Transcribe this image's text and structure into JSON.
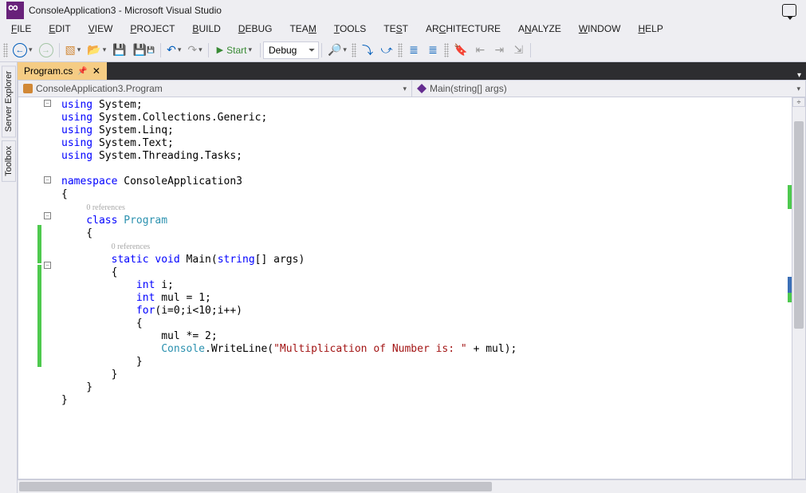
{
  "title": "ConsoleApplication3 - Microsoft Visual Studio",
  "menu": {
    "items": [
      {
        "label": "FILE",
        "key": "F"
      },
      {
        "label": "EDIT",
        "key": "E"
      },
      {
        "label": "VIEW",
        "key": "V"
      },
      {
        "label": "PROJECT",
        "key": "P"
      },
      {
        "label": "BUILD",
        "key": "B"
      },
      {
        "label": "DEBUG",
        "key": "D"
      },
      {
        "label": "TEAM",
        "key": "M"
      },
      {
        "label": "TOOLS",
        "key": "T"
      },
      {
        "label": "TEST",
        "key": "S"
      },
      {
        "label": "ARCHITECTURE",
        "key": "C"
      },
      {
        "label": "ANALYZE",
        "key": "N"
      },
      {
        "label": "WINDOW",
        "key": "W"
      },
      {
        "label": "HELP",
        "key": "H"
      }
    ]
  },
  "toolbar": {
    "start_label": "Start",
    "config_value": "Debug"
  },
  "side_tabs": {
    "server_explorer": "Server Explorer",
    "toolbox": "Toolbox"
  },
  "doc_tab": {
    "filename": "Program.cs"
  },
  "nav": {
    "scope": "ConsoleApplication3.Program",
    "member": "Main(string[] args)"
  },
  "code": {
    "refs_label": "0 references",
    "lines": {
      "l1a": "using",
      "l1b": " System;",
      "l2a": "using",
      "l2b": " System.Collections.Generic;",
      "l3a": "using",
      "l3b": " System.Linq;",
      "l4a": "using",
      "l4b": " System.Text;",
      "l5a": "using",
      "l5b": " System.Threading.Tasks;",
      "l7a": "namespace",
      "l7b": " ConsoleApplication3",
      "l8": "{",
      "l10a": "    class",
      "l10b": " Program",
      "l11": "    {",
      "l13a": "        static",
      "l13b": " void",
      "l13c": " Main(",
      "l13d": "string",
      "l13e": "[] args)",
      "l14": "        {",
      "l15a": "            int",
      "l15b": " i;",
      "l16a": "            int",
      "l16b": " mul = 1;",
      "l17a": "            for",
      "l17b": "(i=0;i<10;i++)",
      "l18": "            {",
      "l19": "                mul *= 2;",
      "l20a": "                Console",
      "l20b": ".WriteLine(",
      "l20c": "\"Multiplication of Number is: \"",
      "l20d": " + mul);",
      "l21": "            }",
      "l22": "        }",
      "l23": "    }",
      "l24": "}"
    }
  }
}
